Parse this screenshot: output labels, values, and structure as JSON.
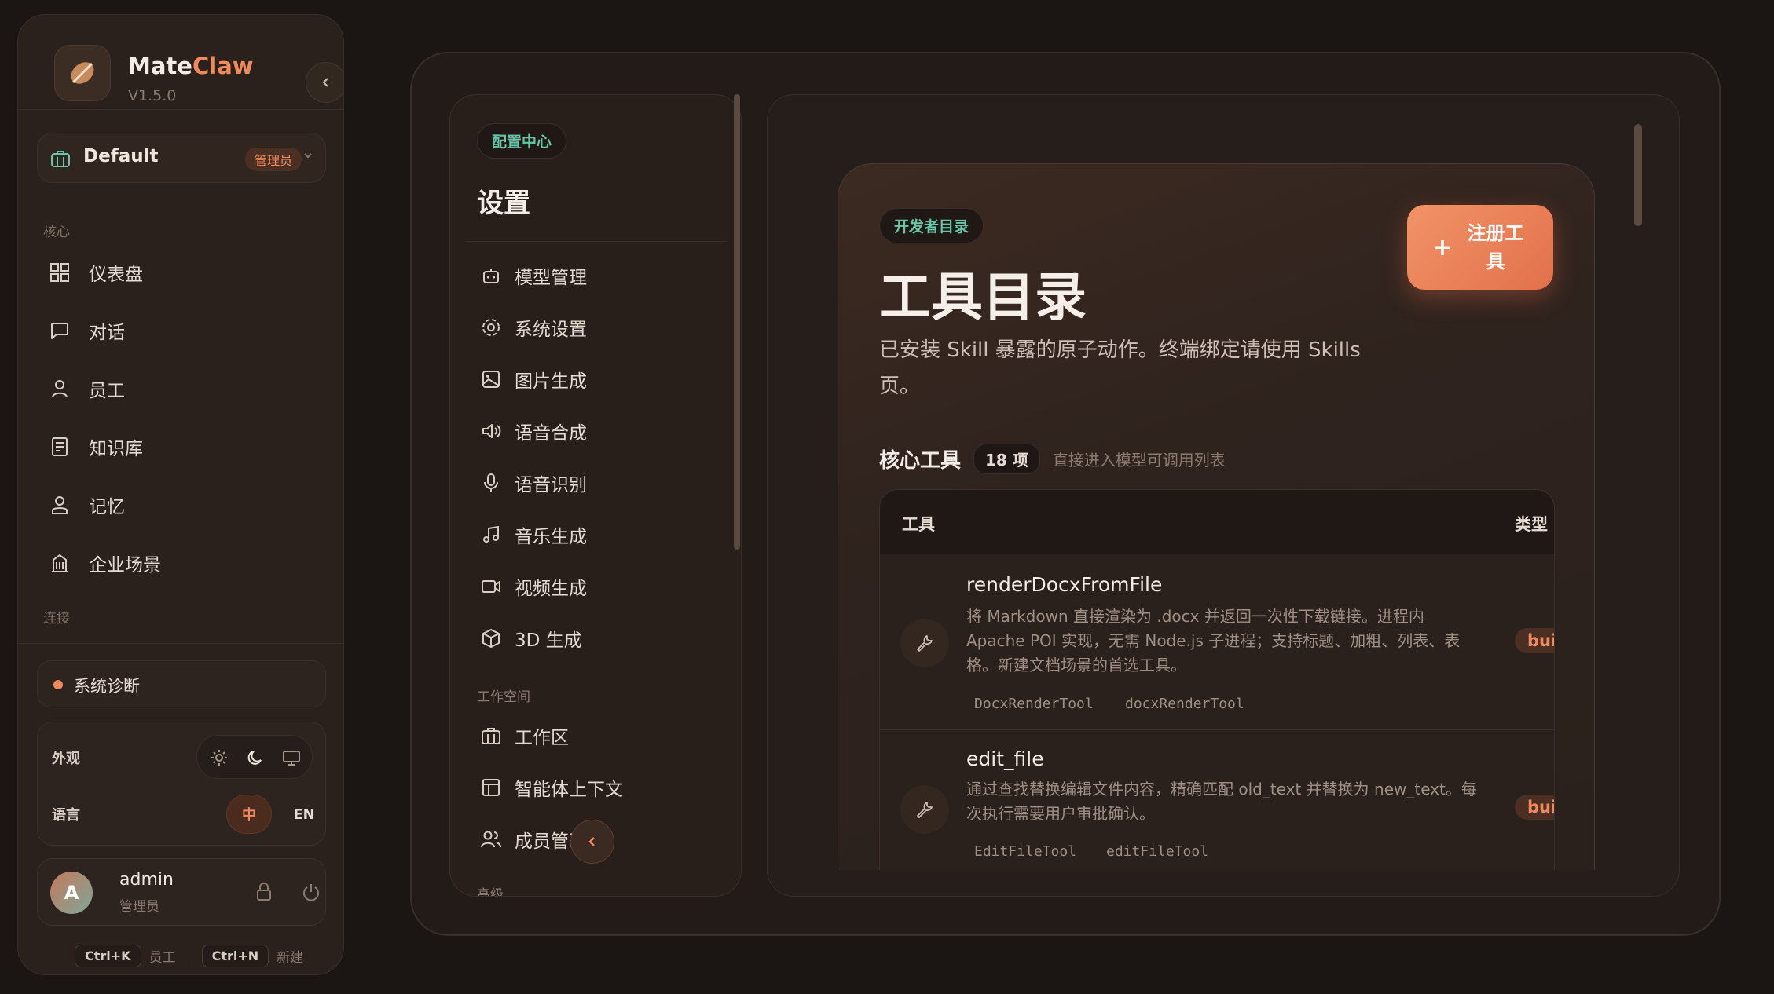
{
  "app": {
    "name_main": "Mate",
    "name_accent": "Claw",
    "version": "V1.5.0"
  },
  "workspace": {
    "name": "Default",
    "role_badge": "管理员"
  },
  "sidebar": {
    "section_core": "核心",
    "items": [
      {
        "label": "仪表盘",
        "icon": "dashboard-icon"
      },
      {
        "label": "对话",
        "icon": "chat-icon"
      },
      {
        "label": "员工",
        "icon": "user-icon"
      },
      {
        "label": "知识库",
        "icon": "book-icon"
      },
      {
        "label": "记忆",
        "icon": "memory-icon"
      },
      {
        "label": "企业场景",
        "icon": "building-icon"
      }
    ],
    "section_connect": "连接",
    "diagnostics": "系统诊断",
    "appearance_label": "外观",
    "language_label": "语言",
    "lang_zh": "中",
    "lang_en": "EN",
    "user": {
      "initial": "A",
      "name": "admin",
      "role": "管理员"
    },
    "shortcuts": [
      {
        "key": "Ctrl+K",
        "label": "员工"
      },
      {
        "key": "Ctrl+N",
        "label": "新建"
      }
    ]
  },
  "settings": {
    "chip": "配置中心",
    "title": "设置",
    "items": [
      {
        "label": "模型管理",
        "icon": "robot-icon"
      },
      {
        "label": "系统设置",
        "icon": "gear-icon"
      },
      {
        "label": "图片生成",
        "icon": "image-icon"
      },
      {
        "label": "语音合成",
        "icon": "speaker-icon"
      },
      {
        "label": "语音识别",
        "icon": "microphone-icon"
      },
      {
        "label": "音乐生成",
        "icon": "music-icon"
      },
      {
        "label": "视频生成",
        "icon": "video-icon"
      },
      {
        "label": "3D 生成",
        "icon": "cube-icon"
      }
    ],
    "section_workspace": "工作空间",
    "workspace_items": [
      {
        "label": "工作区",
        "icon": "briefcase-icon"
      },
      {
        "label": "智能体上下文",
        "icon": "layout-icon"
      },
      {
        "label": "成员管理",
        "icon": "users-icon"
      }
    ],
    "section_advanced": "高级"
  },
  "catalog": {
    "chip": "开发者目录",
    "title": "工具目录",
    "description": "已安装 Skill 暴露的原子动作。终端绑定请使用 Skills 页。",
    "register_button": "注册工具",
    "core_title": "核心工具",
    "core_count": "18 项",
    "core_hint": "直接进入模型可调用列表",
    "table": {
      "col_tool": "工具",
      "col_type": "类型",
      "rows": [
        {
          "name": "renderDocxFromFile",
          "description": "将 Markdown 直接渲染为 .docx 并返回一次性下载链接。进程内 Apache POI 实现，无需 Node.js 子进程；支持标题、加粗、列表、表格。新建文档场景的首选工具。",
          "aliases": [
            "DocxRenderTool",
            "docxRenderTool"
          ],
          "type": "bui"
        },
        {
          "name": "edit_file",
          "description": "通过查找替换编辑文件内容，精确匹配 old_text 并替换为 new_text。每次执行需要用户审批确认。",
          "aliases": [
            "EditFileTool",
            "editFileTool"
          ],
          "type": "bui"
        }
      ]
    }
  },
  "colors": {
    "accent": "#f08a5d",
    "teal": "#67c5a9",
    "background": "#1b1613"
  }
}
